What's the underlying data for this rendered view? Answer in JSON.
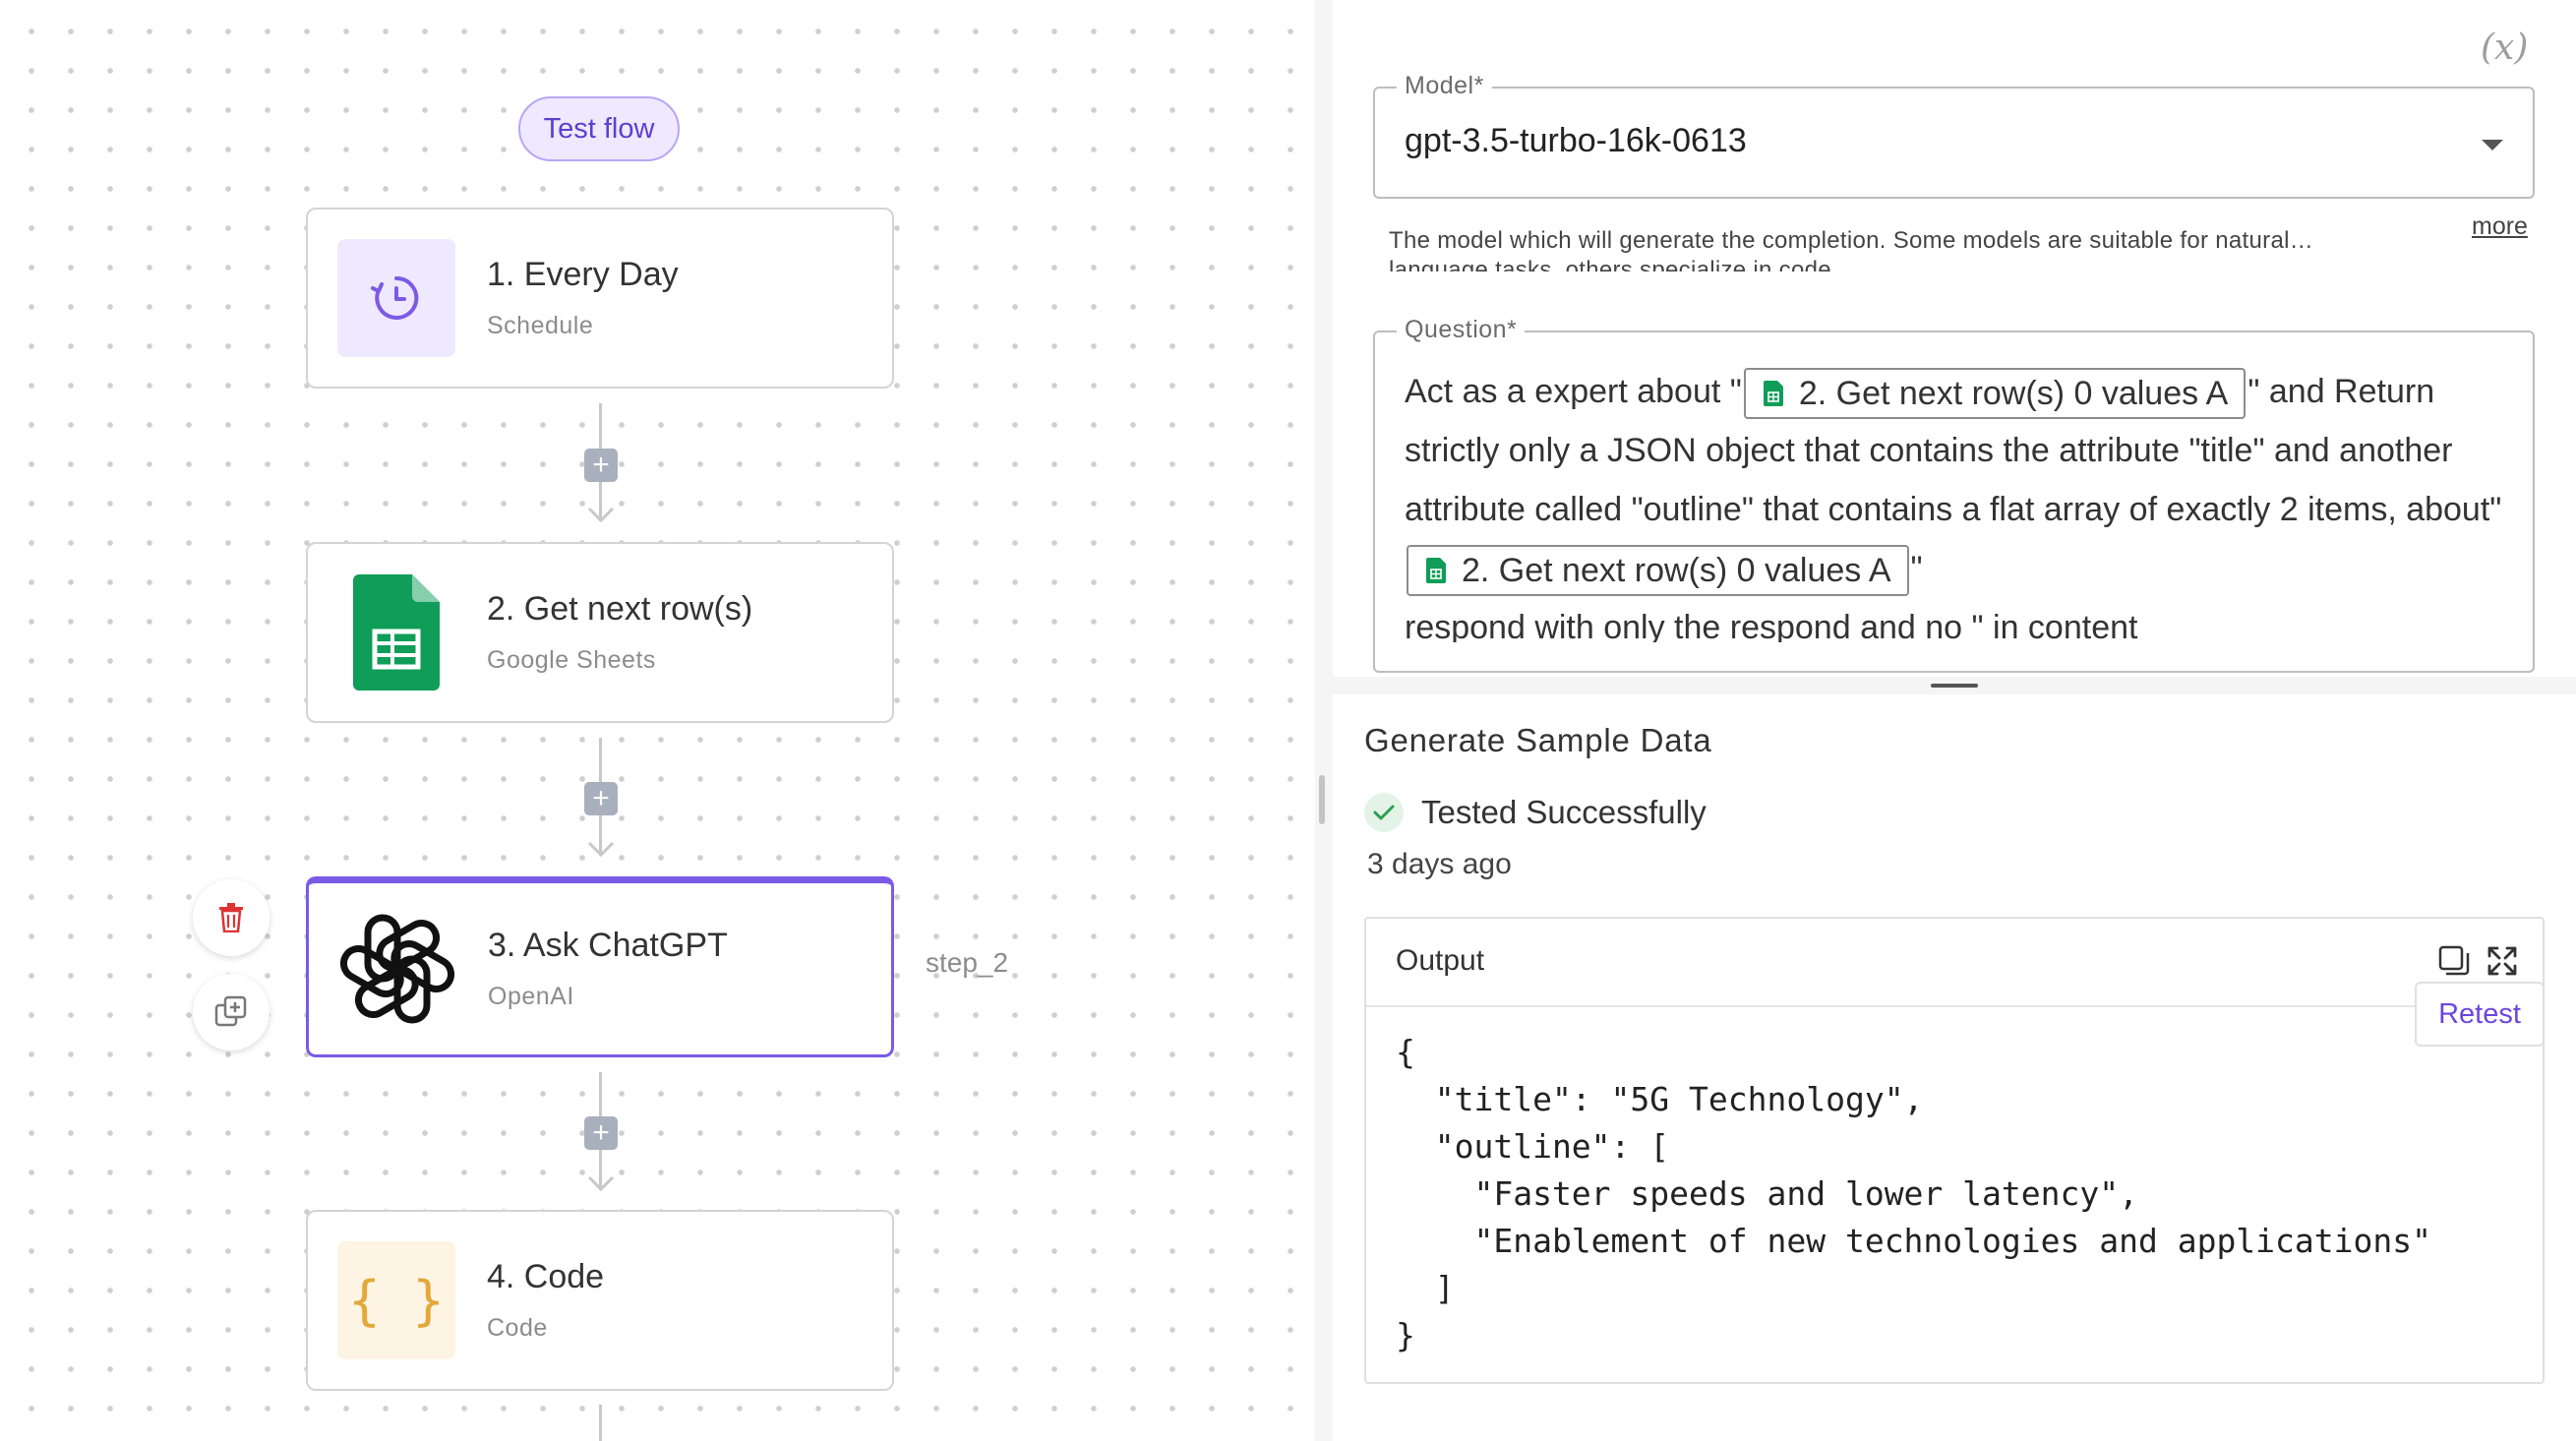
{
  "canvas": {
    "test_flow_label": "Test flow",
    "steps": [
      {
        "title": "1. Every Day",
        "subtitle": "Schedule",
        "icon": "schedule-clock-icon"
      },
      {
        "title": "2. Get next row(s)",
        "subtitle": "Google Sheets",
        "icon": "google-sheets-icon"
      },
      {
        "title": "3. Ask ChatGPT",
        "subtitle": "OpenAI",
        "icon": "openai-icon"
      },
      {
        "title": "4. Code",
        "subtitle": "Code",
        "icon": "code-braces-icon"
      }
    ],
    "selected_step_alias": "step_2",
    "colors": {
      "accent": "#7c5ae6",
      "sheets_green": "#0f9d58",
      "connector": "#c8c8c8"
    }
  },
  "settings": {
    "variables_icon_label": "(x)",
    "model": {
      "label": "Model*",
      "value": "gpt-3.5-turbo-16k-0613",
      "help_text": "The model which will generate the completion. Some models are suitable for natural… language tasks, others specialize in code.",
      "more_link": "more"
    },
    "question": {
      "label": "Question*",
      "text_1": "Act as a expert about \"",
      "chip_1": "2. Get next row(s) 0 values A",
      "text_2": "\" and Return strictly only a JSON object that contains the attribute \"title\" and another attribute called \"outline\" that contains a flat array of exactly 2 items, about\"",
      "chip_2": "2. Get next row(s) 0 values A",
      "text_3": "\"",
      "text_4": "respond with only the respond and no \" in content"
    }
  },
  "sample_data": {
    "title": "Generate Sample Data",
    "status": "Tested Successfully",
    "timestamp": "3 days ago",
    "output_label": "Output",
    "retest_label": "Retest",
    "output_json": "{\n  \"title\": \"5G Technology\",\n  \"outline\": [\n    \"Faster speeds and lower latency\",\n    \"Enablement of new technologies and applications\"\n  ]\n}"
  }
}
